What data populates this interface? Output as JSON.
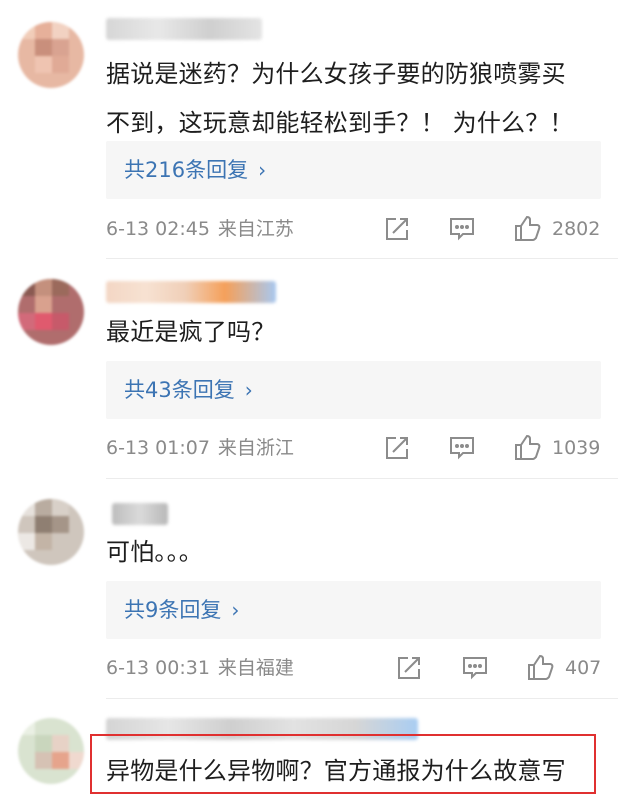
{
  "comments": [
    {
      "text_line1": "据说是迷药？为什么女孩子要的防狼喷雾买",
      "text_line2": "不到，这玩意却能轻松到手？！ 为什么？！",
      "replies_label": "共216条回复",
      "time": "6-13 02:45",
      "source": "来自江苏",
      "likes": "2802"
    },
    {
      "text_line1": "最近是疯了吗？",
      "replies_label": "共43条回复",
      "time": "6-13 01:07",
      "source": "来自浙江",
      "likes": "1039"
    },
    {
      "text_line1": "可怕。。。",
      "replies_label": "共9条回复",
      "time": "6-13 00:31",
      "source": "来自福建",
      "likes": "407"
    },
    {
      "text_line1": "异物是什么异物啊？官方通报为什么故意写"
    }
  ],
  "icons": {
    "chevron": "chevron-right-icon",
    "share": "share-icon",
    "comment": "comment-icon",
    "like": "thumbs-up-icon"
  },
  "colors": {
    "reply_link": "#3c74b3",
    "highlight_border": "#e03030"
  }
}
